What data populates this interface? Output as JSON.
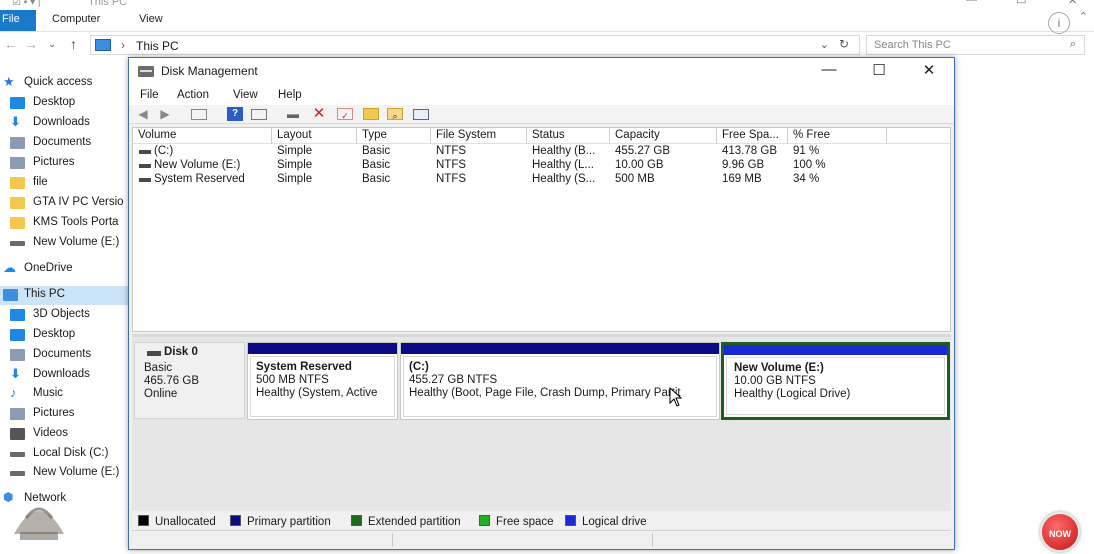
{
  "explorer": {
    "title": "This PC",
    "ribbon_tabs": [
      "File",
      "Computer",
      "View"
    ],
    "address_path": "This PC",
    "search_placeholder": "Search This PC",
    "nav": [
      {
        "label": "Quick access",
        "icon": "star-icon",
        "color": "#2b79d0"
      },
      {
        "label": "Desktop",
        "icon": "desktop-icon",
        "color": "#1e88e5"
      },
      {
        "label": "Downloads",
        "icon": "download-icon",
        "color": "#1e88e5"
      },
      {
        "label": "Documents",
        "icon": "documents-icon",
        "color": "#8a9bb3"
      },
      {
        "label": "Pictures",
        "icon": "pictures-icon",
        "color": "#8a9bb3"
      },
      {
        "label": "file",
        "icon": "folder-icon",
        "color": "#f2c94c"
      },
      {
        "label": "GTA IV PC Versio",
        "icon": "folder-icon",
        "color": "#f2c94c"
      },
      {
        "label": "KMS Tools Porta",
        "icon": "folder-icon",
        "color": "#f2c94c"
      },
      {
        "label": "New Volume (E:)",
        "icon": "drive-icon",
        "color": "#6b6b6b"
      },
      {
        "label": "OneDrive",
        "icon": "onedrive-icon",
        "color": "#1e88e5"
      },
      {
        "label": "This PC",
        "icon": "computer-icon",
        "color": "#3d8ee0",
        "selected": true
      },
      {
        "label": "3D Objects",
        "icon": "3d-objects-icon",
        "color": "#1e88e5"
      },
      {
        "label": "Desktop",
        "icon": "desktop-icon",
        "color": "#1e88e5"
      },
      {
        "label": "Documents",
        "icon": "documents-icon",
        "color": "#8a9bb3"
      },
      {
        "label": "Downloads",
        "icon": "download-icon",
        "color": "#1e88e5"
      },
      {
        "label": "Music",
        "icon": "music-icon",
        "color": "#1e88e5"
      },
      {
        "label": "Pictures",
        "icon": "pictures-icon",
        "color": "#8a9bb3"
      },
      {
        "label": "Videos",
        "icon": "videos-icon",
        "color": "#555555"
      },
      {
        "label": "Local Disk (C:)",
        "icon": "drive-icon",
        "color": "#6b6b6b"
      },
      {
        "label": "New Volume (E:)",
        "icon": "drive-icon",
        "color": "#6b6b6b"
      },
      {
        "label": "Network",
        "icon": "network-icon",
        "color": "#3d8ee0"
      }
    ],
    "subscribe_badge": "NOW"
  },
  "diskmgmt": {
    "title": "Disk Management",
    "menu": [
      "File",
      "Action",
      "View",
      "Help"
    ],
    "columns": [
      "Volume",
      "Layout",
      "Type",
      "File System",
      "Status",
      "Capacity",
      "Free Spa...",
      "% Free"
    ],
    "volumes": [
      [
        "(C:)",
        "Simple",
        "Basic",
        "NTFS",
        "Healthy (B...",
        "455.27 GB",
        "413.78 GB",
        "91 %"
      ],
      [
        "New Volume (E:)",
        "Simple",
        "Basic",
        "NTFS",
        "Healthy (L...",
        "10.00 GB",
        "9.96 GB",
        "100 %"
      ],
      [
        "System Reserved",
        "Simple",
        "Basic",
        "NTFS",
        "Healthy (S...",
        "500 MB",
        "169 MB",
        "34 %"
      ]
    ],
    "disk": {
      "name": "Disk 0",
      "type": "Basic",
      "size": "465.76 GB",
      "state": "Online"
    },
    "partitions": [
      {
        "name": "System Reserved",
        "size": "500 MB NTFS",
        "status": "Healthy (System, Active"
      },
      {
        "name": "(C:)",
        "size": "455.27 GB NTFS",
        "status": "Healthy (Boot, Page File, Crash Dump, Primary Partit"
      },
      {
        "name": "New Volume  (E:)",
        "size": "10.00 GB NTFS",
        "status": "Healthy (Logical Drive)"
      }
    ],
    "legend": [
      {
        "label": "Unallocated",
        "color": "#000000"
      },
      {
        "label": "Primary partition",
        "color": "#0b0b86"
      },
      {
        "label": "Extended partition",
        "color": "#1b6b1b"
      },
      {
        "label": "Free space",
        "color": "#22b022"
      },
      {
        "label": "Logical drive",
        "color": "#1a29d6"
      }
    ]
  }
}
